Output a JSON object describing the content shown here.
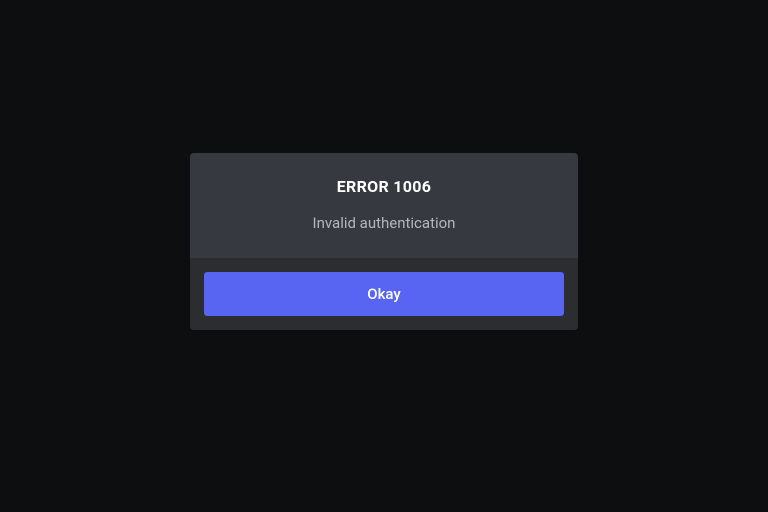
{
  "modal": {
    "title": "ERROR 1006",
    "message": "Invalid authentication",
    "button_label": "Okay"
  },
  "colors": {
    "background": "#0d0e10",
    "modal_content": "#36393f",
    "modal_footer": "#2b2d31",
    "primary_button": "#5865f2",
    "text_primary": "#ffffff",
    "text_secondary": "#b3b6bc"
  }
}
